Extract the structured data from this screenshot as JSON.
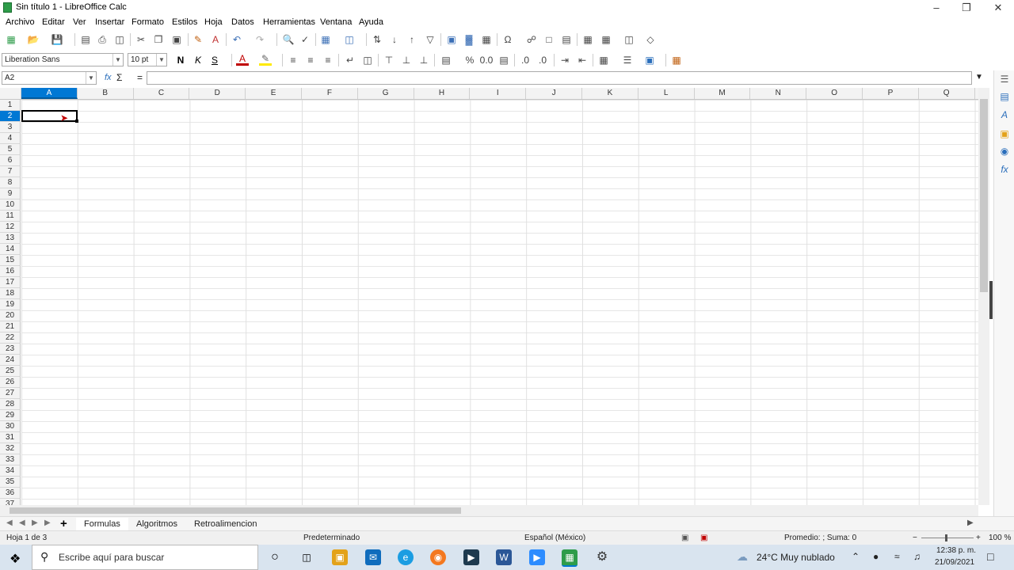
{
  "window": {
    "title": "Sin título 1 - LibreOffice Calc"
  },
  "menu": [
    "Archivo",
    "Editar",
    "Ver",
    "Insertar",
    "Formato",
    "Estilos",
    "Hoja",
    "Datos",
    "Herramientas",
    "Ventana",
    "Ayuda"
  ],
  "format_bar": {
    "font_name": "Liberation Sans",
    "font_size": "10 pt",
    "bold": "N",
    "italic": "K",
    "underline": "S"
  },
  "formula_bar": {
    "cell_ref": "A2",
    "fx": "fx",
    "sum": "Σ",
    "equals": "="
  },
  "columns": [
    "A",
    "B",
    "C",
    "D",
    "E",
    "F",
    "G",
    "H",
    "I",
    "J",
    "K",
    "L",
    "M",
    "N",
    "O",
    "P",
    "Q"
  ],
  "rows": [
    "1",
    "2",
    "3",
    "4",
    "5",
    "6",
    "7",
    "8",
    "9",
    "10",
    "11",
    "12",
    "13",
    "14",
    "15",
    "16",
    "17",
    "18",
    "19",
    "20",
    "21",
    "22",
    "23",
    "24",
    "25",
    "26",
    "27",
    "28",
    "29",
    "30",
    "31",
    "32",
    "33",
    "34",
    "35",
    "36",
    "37"
  ],
  "sheets": [
    "Formulas",
    "Algoritmos",
    "Retroalimencion"
  ],
  "status": {
    "sheet_info": "Hoja 1 de 3",
    "style": "Predeterminado",
    "language": "Español (México)",
    "summary": "Promedio: ; Suma: 0",
    "zoom": "100 %"
  },
  "taskbar": {
    "search_placeholder": "Escribe aquí para buscar",
    "weather": "24°C  Muy nublado",
    "time": "12:38 p. m.",
    "date": "21/09/2021"
  },
  "colors": {
    "accent": "#0078d4"
  }
}
